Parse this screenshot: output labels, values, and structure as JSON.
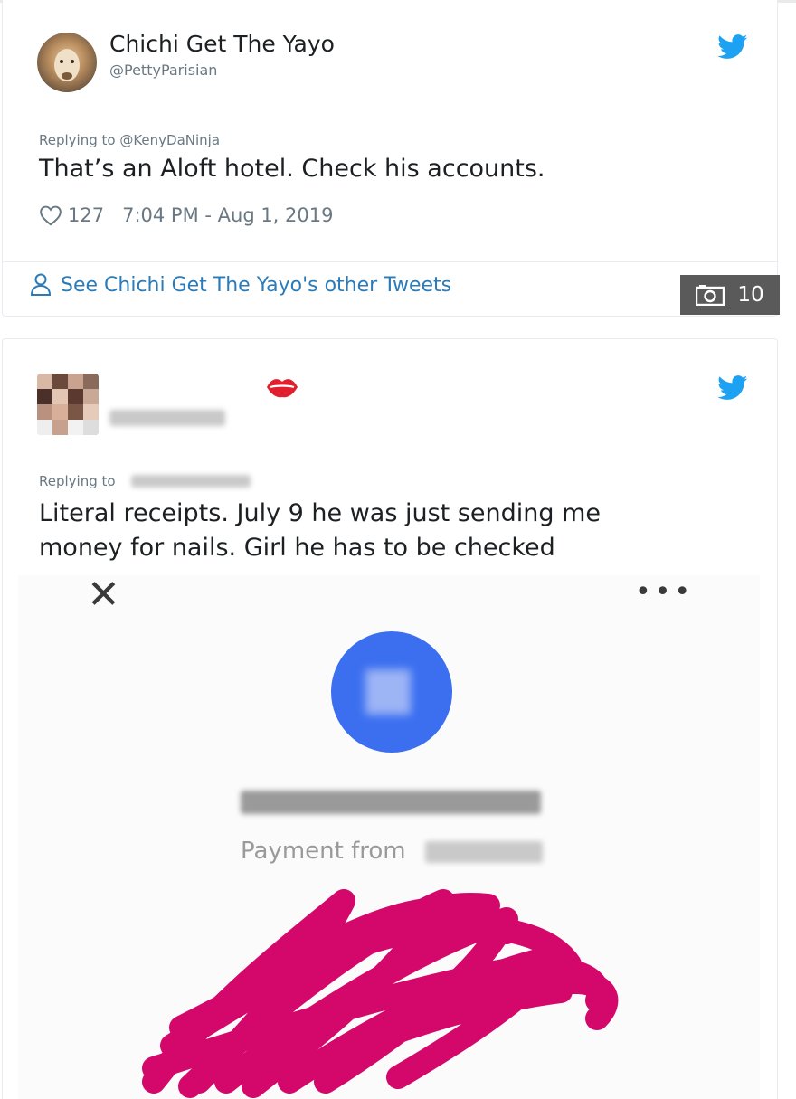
{
  "tweet1": {
    "display_name": "Chichi Get The Yayo",
    "handle": "@PettyParisian",
    "replying_to": "Replying to @KenyDaNinja",
    "text": "That’s an Aloft hotel. Check his accounts.",
    "likes": "127",
    "timestamp": "7:04 PM - Aug 1, 2019",
    "see_other": "See Chichi Get The Yayo's other Tweets",
    "photo_count": "10"
  },
  "tweet2": {
    "replying_to_label": "Replying to",
    "text_line1": "Literal receipts. July 9 he was just sending me",
    "text_line2": "money for nails. Girl he has to be checked",
    "screenshot": {
      "payment_from_label": "Payment from"
    }
  },
  "colors": {
    "twitter_blue": "#1da1f2",
    "link_blue": "#2b7bb9",
    "payment_blue": "#3b6ff0",
    "scribble_pink": "#d4086b",
    "lips_red": "#e0202f"
  },
  "icons": {
    "bird": "twitter-bird-icon",
    "heart": "heart-icon",
    "person": "person-icon",
    "camera": "camera-icon",
    "lips": "lips-emoji-icon",
    "close": "close-icon",
    "more": "more-dots-icon"
  }
}
